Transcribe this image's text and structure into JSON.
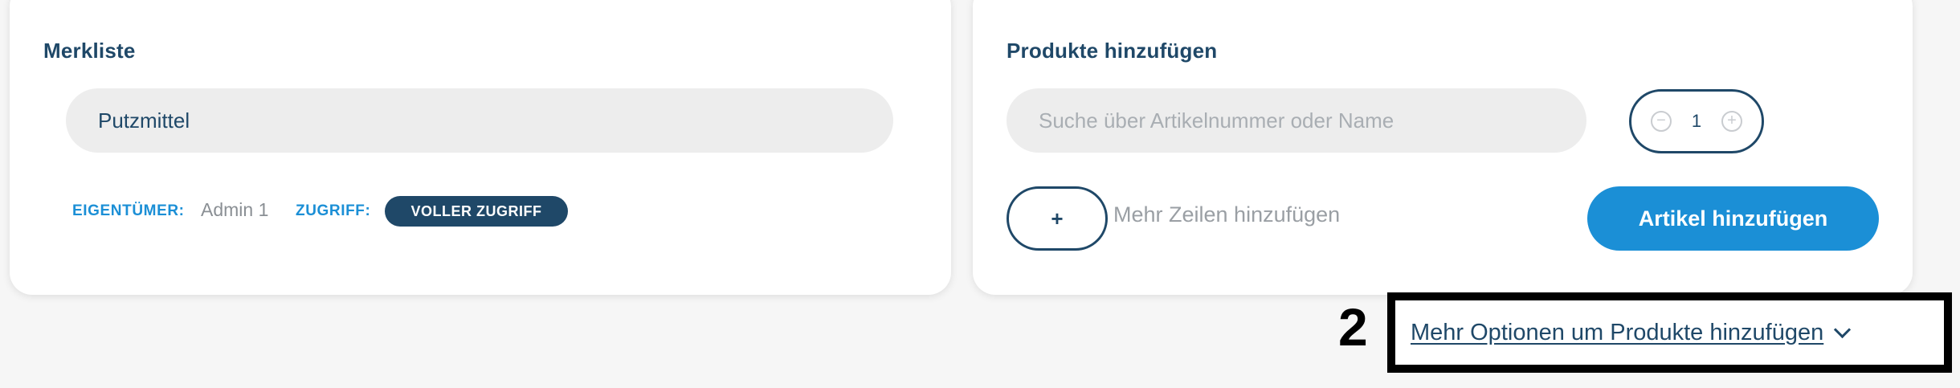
{
  "merkliste": {
    "title": "Merkliste",
    "list_name_value": "Putzmittel",
    "owner_label": "EIGENTÜMER:",
    "owner_value": "Admin 1",
    "access_label": "ZUGRIFF:",
    "access_value": "VOLLER ZUGRIFF"
  },
  "add_products": {
    "title": "Produkte hinzufügen",
    "search_placeholder": "Suche über Artikelnummer oder Name",
    "quantity": "1",
    "decrement_symbol": "−",
    "increment_symbol": "+",
    "add_rows_button": "+",
    "add_rows_label": "Mehr Zeilen hinzufügen",
    "add_items_button": "Artikel hinzufügen"
  },
  "more_options": {
    "link_label": "Mehr Optionen um Produkte hinzufügen",
    "icon": "chevron-down-icon"
  },
  "annotation": {
    "number": "2"
  },
  "colors": {
    "navy": "#1f4868",
    "accent_blue": "#1b8fd6",
    "input_bg": "#ededed",
    "page_bg": "#f6f6f6"
  }
}
